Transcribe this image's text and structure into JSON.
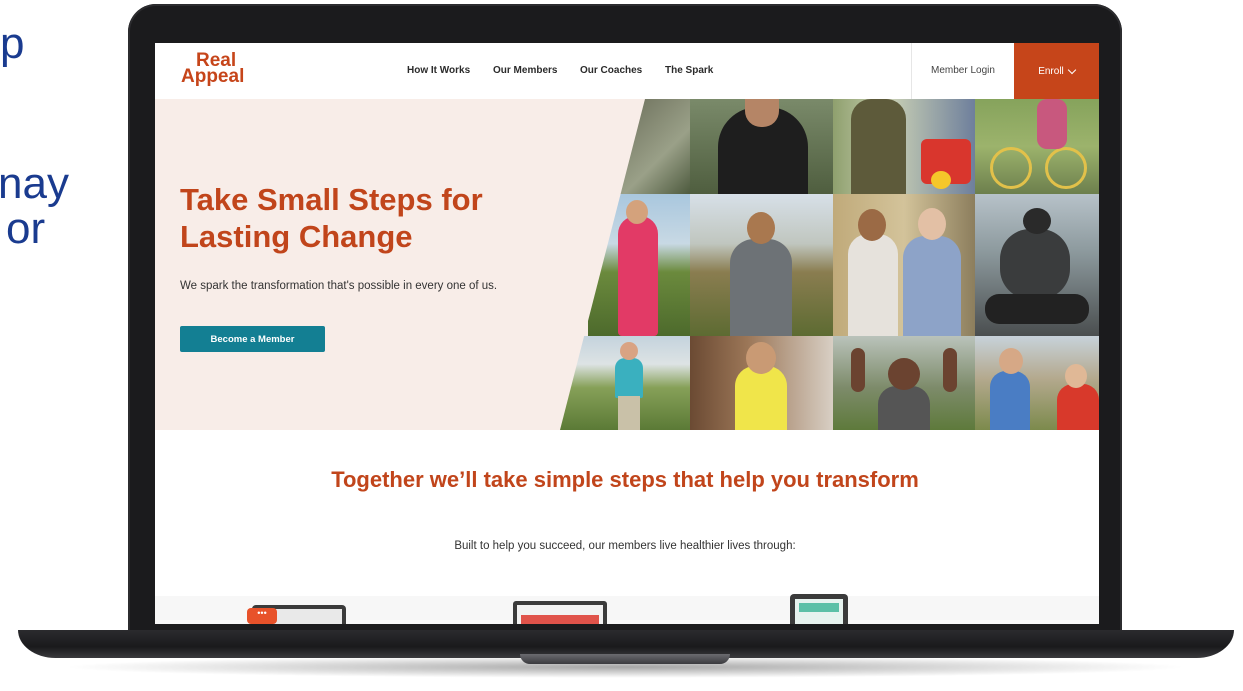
{
  "slide_fragments": [
    "p",
    "nay",
    "or"
  ],
  "nav": {
    "logo_line1": "Real",
    "logo_line2": "Appeal",
    "links": [
      "How It Works",
      "Our Members",
      "Our Coaches",
      "The Spark"
    ],
    "member_login": "Member Login",
    "enroll": "Enroll"
  },
  "hero": {
    "title": "Take Small Steps for Lasting Change",
    "subtitle": "We spark the transformation that's possible in every one of us.",
    "button": "Become a Member"
  },
  "section": {
    "title": "Together we’ll take simple steps that help you transform",
    "subtitle": "Built to help you succeed, our members live healthier lives through:"
  },
  "colors": {
    "brand_orange": "#c6451a",
    "button_teal": "#137f93",
    "hero_bg": "#f8ede8"
  },
  "icons": [
    "chevron-down-icon",
    "chat-device-icon",
    "laptop-app-icon",
    "tablet-app-icon"
  ]
}
